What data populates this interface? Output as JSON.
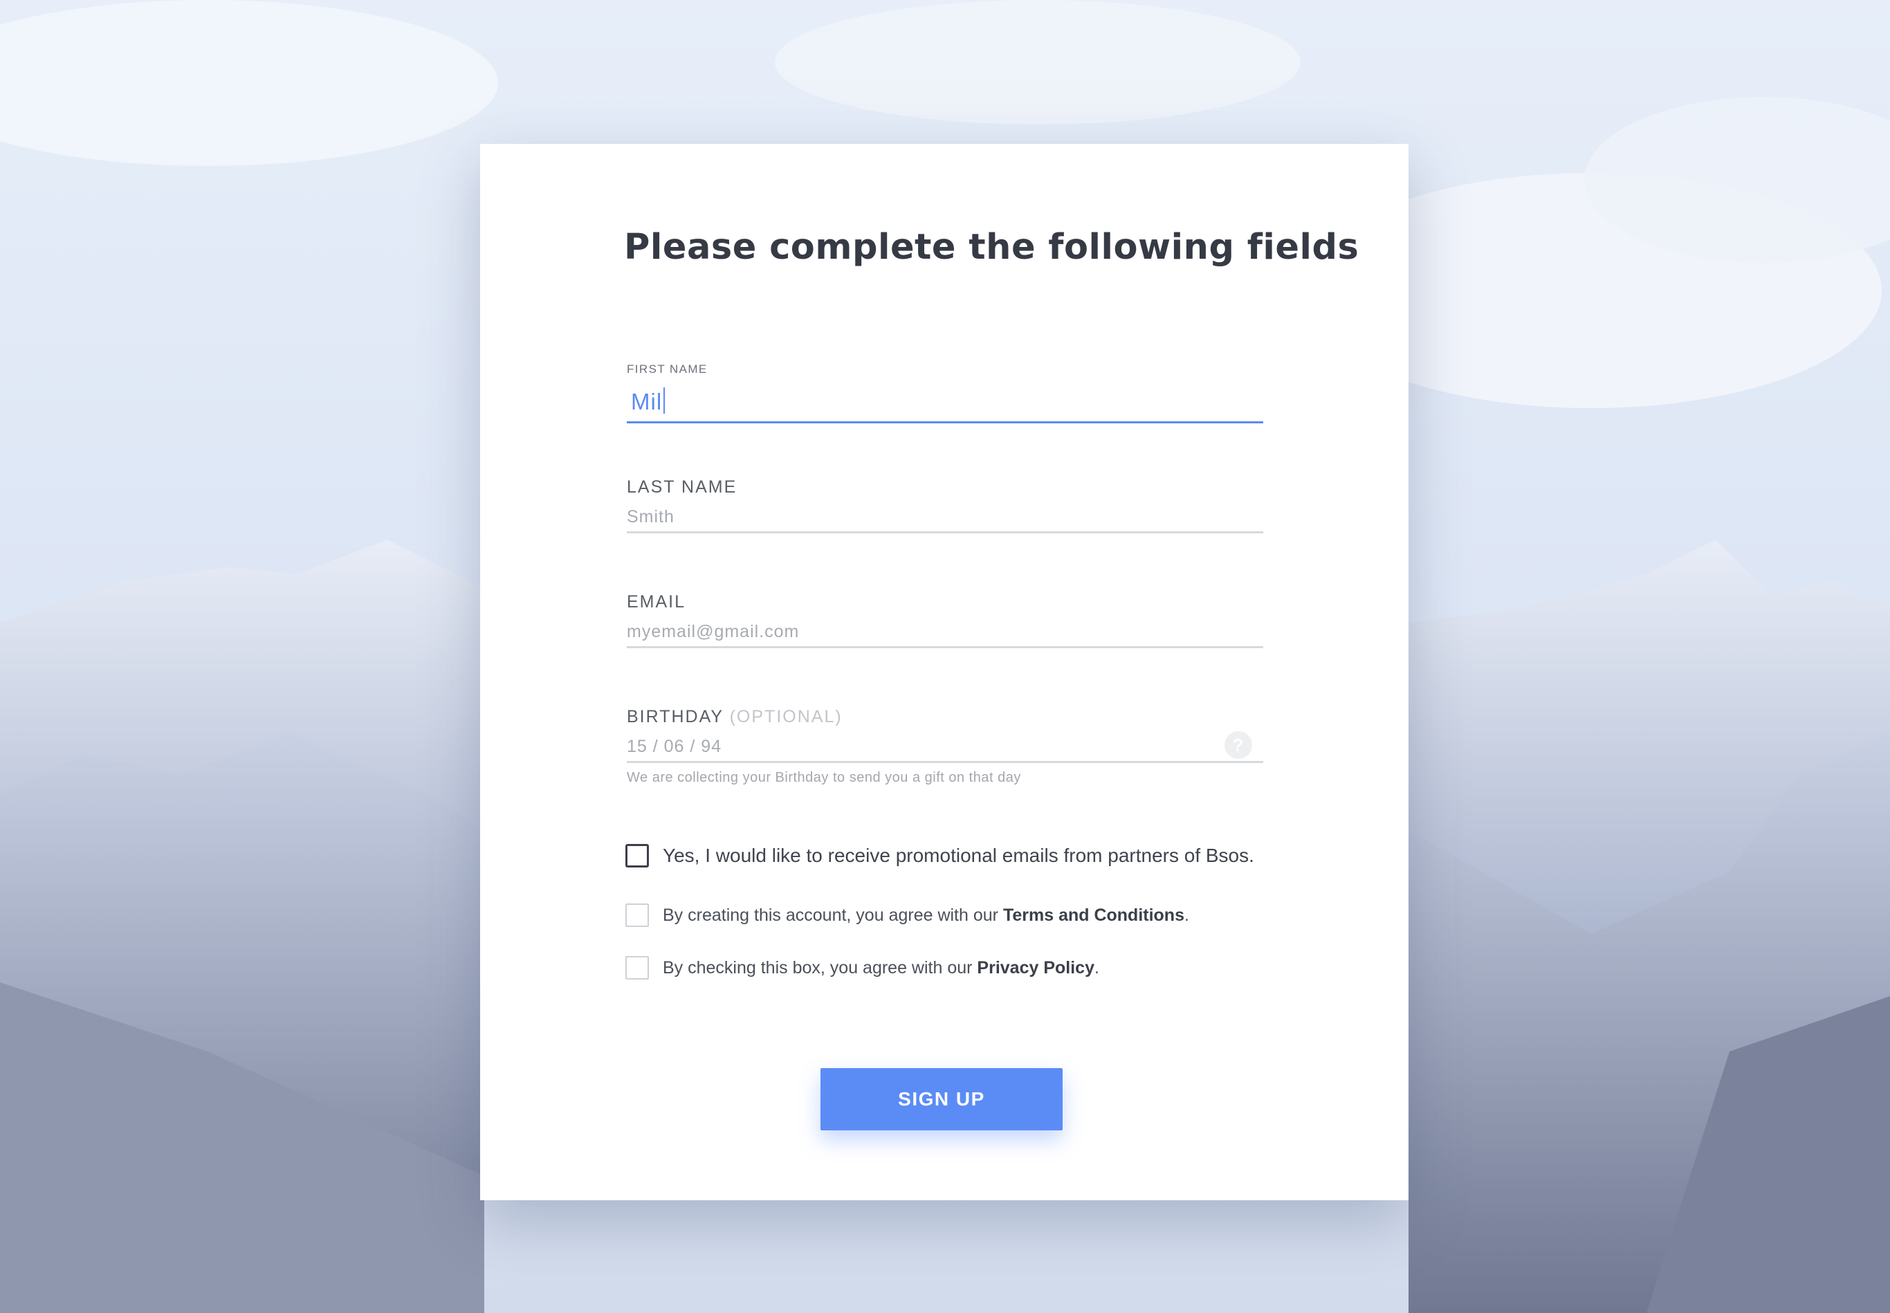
{
  "form": {
    "title": "Please complete the following fields",
    "first_name": {
      "label": "FIRST NAME",
      "value": "Mil"
    },
    "last_name": {
      "label": "LAST NAME",
      "placeholder": "Smith"
    },
    "email": {
      "label": "EMAIL",
      "placeholder": "myemail@gmail.com"
    },
    "birthday": {
      "label": "BIRTHDAY",
      "optional_tag": "(OPTIONAL)",
      "placeholder": "15 / 06 / 94",
      "help_glyph": "?",
      "hint": "We are collecting your Birthday to send you a gift on that day"
    },
    "checkboxes": {
      "promo": {
        "text": "Yes, I would like to receive promotional emails from partners of Bsos.",
        "checked": false
      },
      "terms": {
        "prefix": "By creating this account, you agree with our ",
        "link": "Terms and Conditions",
        "suffix": ".",
        "checked": false
      },
      "privacy": {
        "prefix": "By checking this box, you agree with our ",
        "link": "Privacy Policy",
        "suffix": ".",
        "checked": false
      }
    },
    "signup_label": "SIGN UP"
  },
  "colors": {
    "accent": "#5b8cf6",
    "title": "#363a45",
    "card": "#ffffff"
  },
  "icons": {
    "help": "question-circle-icon",
    "background": "snowy-mountains-photo"
  }
}
